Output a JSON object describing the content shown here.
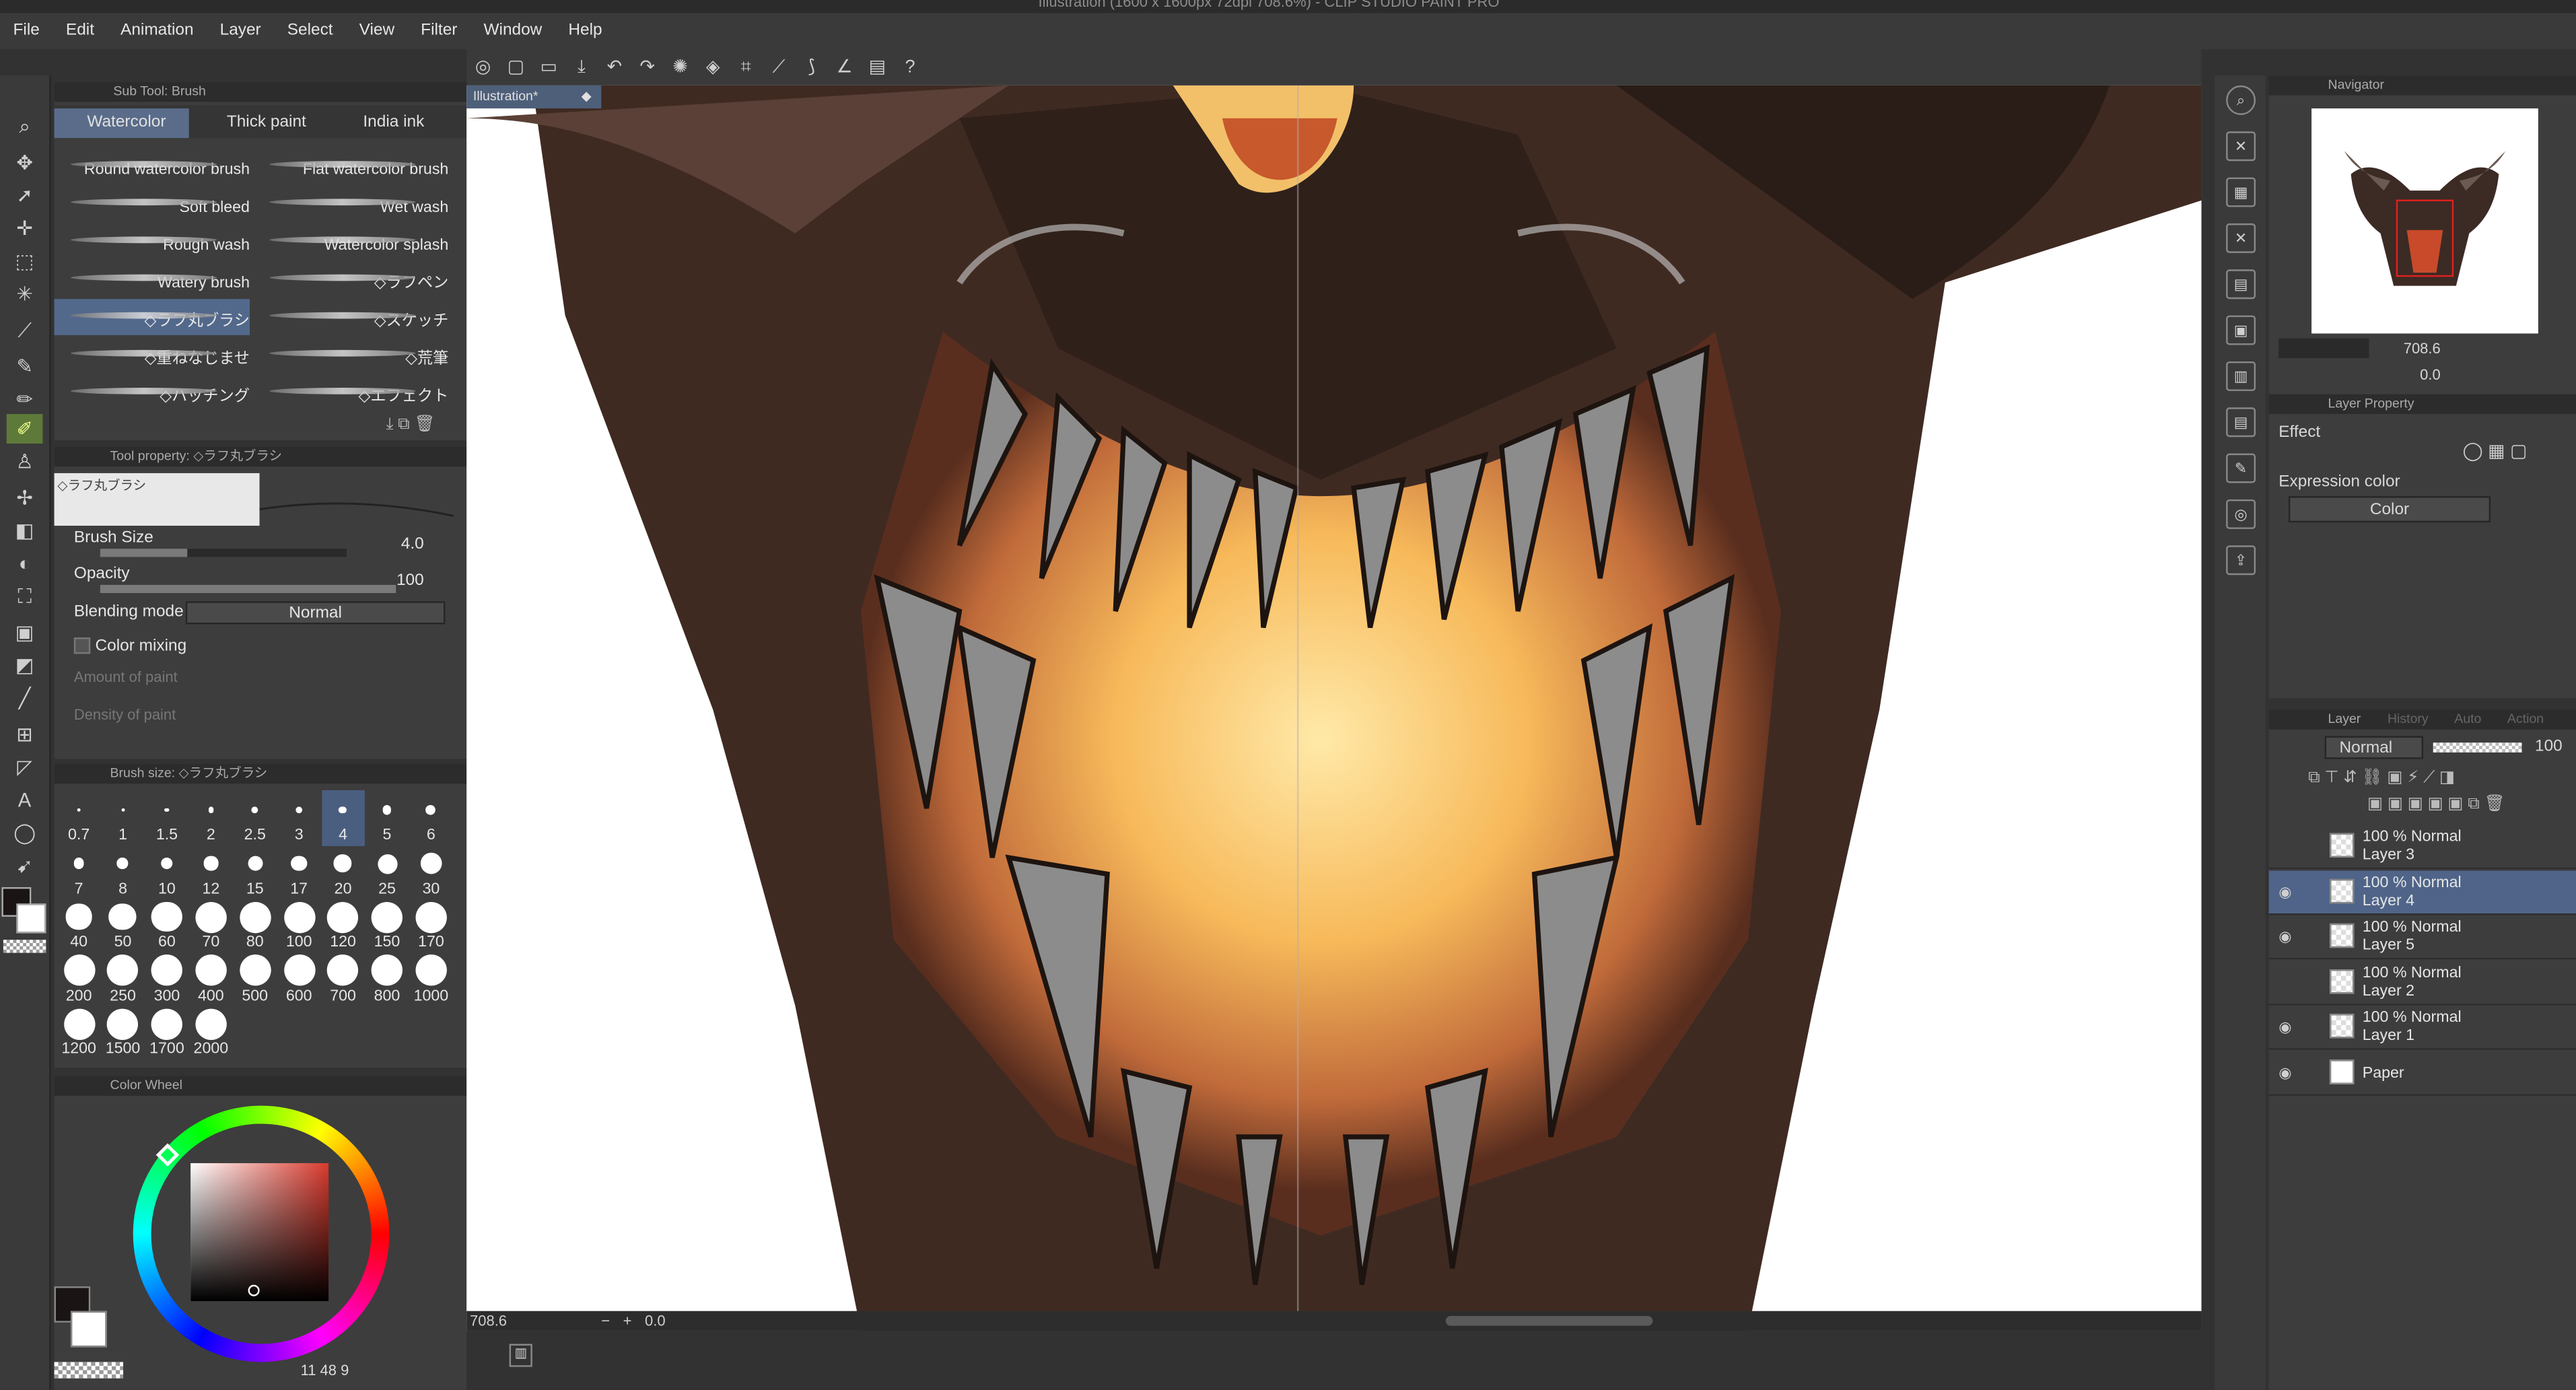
{
  "app": {
    "title": "Illustration (1600 x 1600px 72dpi 708.6%) - CLIP STUDIO PAINT PRO"
  },
  "menu": [
    "File",
    "Edit",
    "Animation",
    "Layer",
    "Select",
    "View",
    "Filter",
    "Window",
    "Help"
  ],
  "subtool": {
    "header": "Sub Tool: Brush",
    "tabs": [
      "Watercolor",
      "Thick paint",
      "India ink"
    ],
    "brushes": [
      "Round watercolor brush",
      "Flat watercolor brush",
      "Soft bleed",
      "Wet wash",
      "Rough wash",
      "Watercolor splash",
      "Watery brush",
      "◇ラフペン",
      "◇ラフ丸ブラシ",
      "◇スケッチ",
      "◇重ねなじませ",
      "◇荒筆",
      "◇ハッチング",
      "◇エフェクト"
    ]
  },
  "toolprop": {
    "header": "Tool property: ◇ラフ丸ブラシ",
    "name": "◇ラフ丸ブラシ",
    "brush_size_label": "Brush Size",
    "brush_size": "4.0",
    "brush_size_level": 0.35,
    "opacity_label": "Opacity",
    "opacity": "100",
    "blending_label": "Blending mode",
    "blending": "Normal",
    "color_mixing": "Color mixing",
    "amount": "Amount of paint",
    "density": "Density of paint"
  },
  "brushsize": {
    "header": "Brush size: ◇ラフ丸ブラシ",
    "sizes": [
      "0.7",
      "1",
      "1.5",
      "2",
      "2.5",
      "3",
      "4",
      "5",
      "6",
      "7",
      "8",
      "10",
      "12",
      "15",
      "17",
      "20",
      "25",
      "30",
      "40",
      "50",
      "60",
      "70",
      "80",
      "100",
      "120",
      "150",
      "170",
      "200",
      "250",
      "300",
      "400",
      "500",
      "600",
      "700",
      "800",
      "1000",
      "1200",
      "1500",
      "1700",
      "2000"
    ],
    "selected": "4"
  },
  "colorwheel": {
    "header": "Color Wheel",
    "readout": "11 48 9",
    "h": "11",
    "s": "48",
    "v": "9",
    "main_color": "#1a1414",
    "sub_color": "#ffffff"
  },
  "document": {
    "tab": "Illustration*"
  },
  "status": {
    "zoom": "708.6",
    "angle": "0.0"
  },
  "navigator": {
    "header": "Navigator",
    "zoom": "708.6",
    "angle": "0.0"
  },
  "layerprop": {
    "header": "Layer Property",
    "effect": "Effect",
    "expression_label": "Expression color",
    "expression": "Color"
  },
  "layerpanel": {
    "tabs": [
      "Layer",
      "History",
      "Auto Action"
    ],
    "blend": "Normal",
    "opacity": "100",
    "layers": [
      {
        "mode": "100 % Normal",
        "name": "Layer 3",
        "visible": false,
        "selected": false
      },
      {
        "mode": "100 % Normal",
        "name": "Layer 4",
        "visible": true,
        "selected": true
      },
      {
        "mode": "100 % Normal",
        "name": "Layer 5",
        "visible": true,
        "selected": false
      },
      {
        "mode": "100 % Normal",
        "name": "Layer 2",
        "visible": false,
        "selected": false
      },
      {
        "mode": "100 % Normal",
        "name": "Layer 1",
        "visible": true,
        "selected": false
      },
      {
        "mode": "",
        "name": "Paper",
        "visible": true,
        "selected": false
      }
    ]
  }
}
